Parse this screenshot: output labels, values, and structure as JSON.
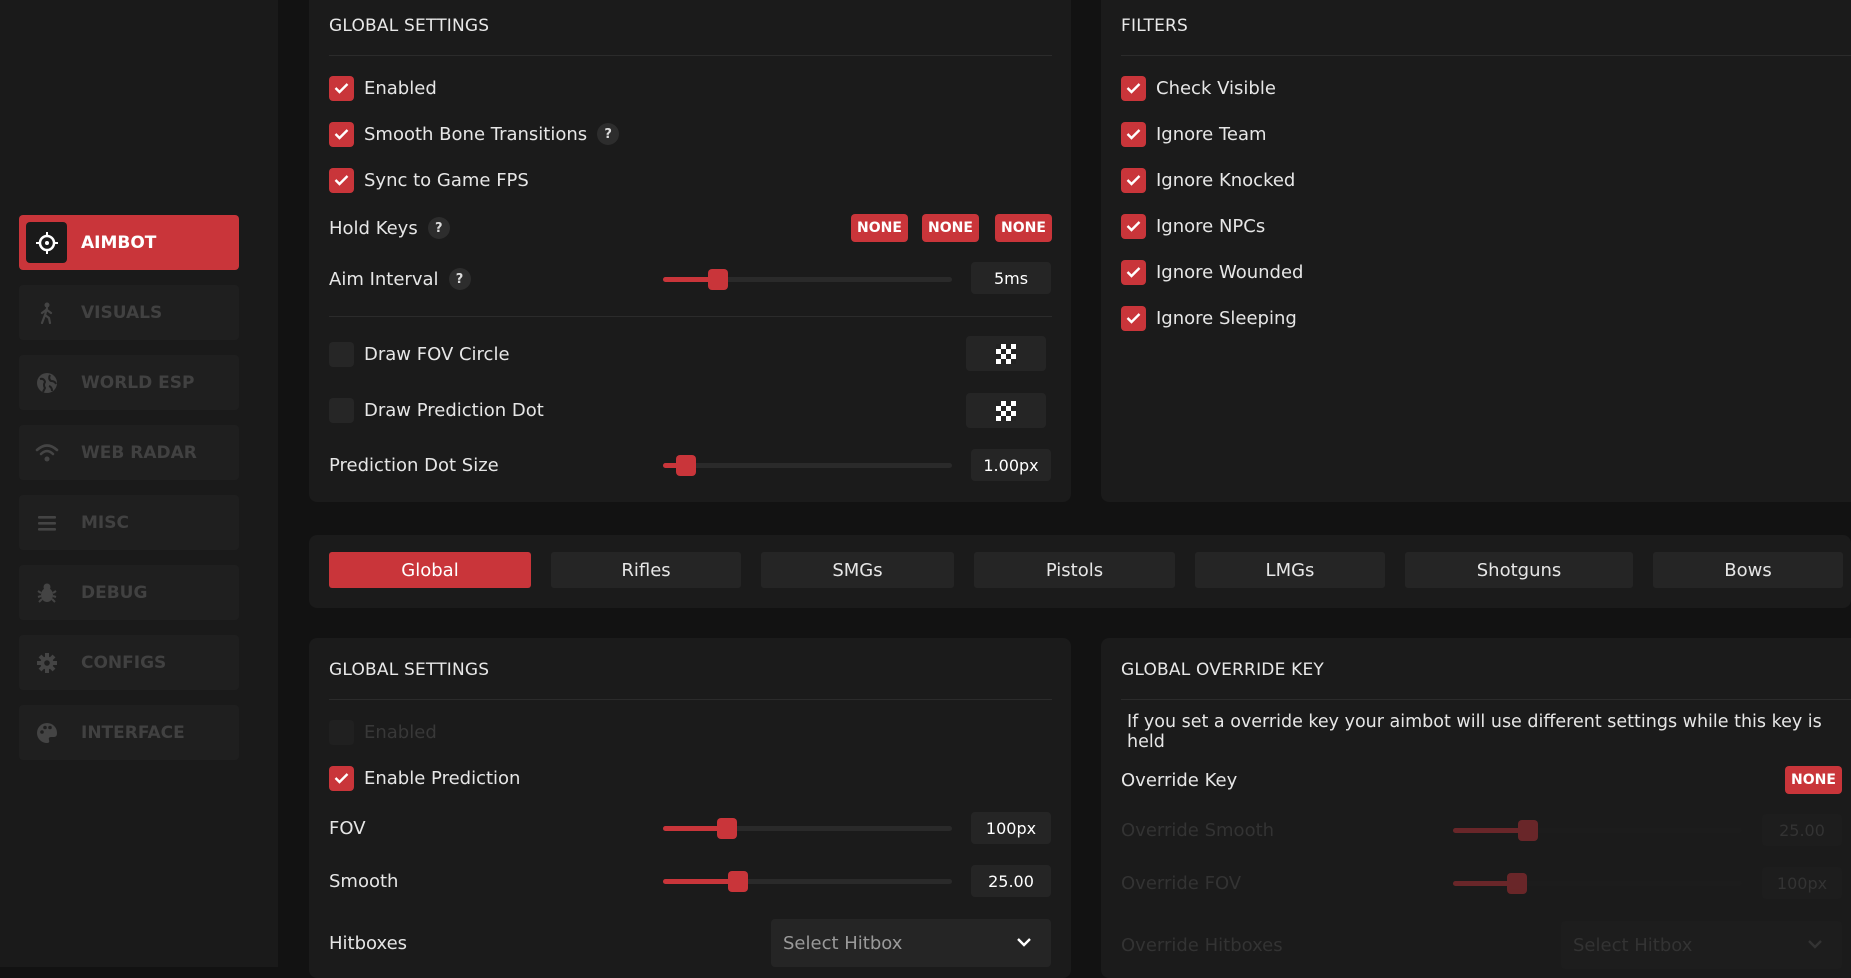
{
  "sidebar": {
    "items": [
      {
        "label": "AIMBOT",
        "icon": "crosshair-icon",
        "active": true
      },
      {
        "label": "VISUALS",
        "icon": "walking-person-icon",
        "active": false
      },
      {
        "label": "WORLD ESP",
        "icon": "globe-icon",
        "active": false
      },
      {
        "label": "WEB RADAR",
        "icon": "wifi-icon",
        "active": false
      },
      {
        "label": "MISC",
        "icon": "menu-lines-icon",
        "active": false
      },
      {
        "label": "DEBUG",
        "icon": "bug-icon",
        "active": false
      },
      {
        "label": "CONFIGS",
        "icon": "gear-icon",
        "active": false
      },
      {
        "label": "INTERFACE",
        "icon": "palette-icon",
        "active": false
      }
    ]
  },
  "global_settings": {
    "title": "GLOBAL SETTINGS",
    "enabled": "Enabled",
    "smooth_bone": "Smooth Bone Transitions",
    "sync_fps": "Sync to Game FPS",
    "hold_keys": "Hold Keys",
    "hold_key_values": [
      "NONE",
      "NONE",
      "NONE"
    ],
    "aim_interval": "Aim Interval",
    "aim_interval_value": "5ms",
    "aim_interval_level": 0.19,
    "draw_fov_circle": "Draw FOV Circle",
    "draw_prediction_dot": "Draw Prediction Dot",
    "prediction_dot_size": "Prediction Dot Size",
    "prediction_dot_size_value": "1.00px",
    "prediction_dot_size_level": 0.08,
    "help": "?"
  },
  "filters": {
    "title": "FILTERS",
    "items": [
      "Check Visible",
      "Ignore Team",
      "Ignore Knocked",
      "Ignore NPCs",
      "Ignore Wounded",
      "Ignore Sleeping"
    ]
  },
  "tabs": [
    "Global",
    "Rifles",
    "SMGs",
    "Pistols",
    "LMGs",
    "Shotguns",
    "Bows"
  ],
  "weapon_settings": {
    "title": "GLOBAL SETTINGS",
    "enabled": "Enabled",
    "enable_prediction": "Enable Prediction",
    "fov": "FOV",
    "fov_value": "100px",
    "fov_level": 0.22,
    "smooth": "Smooth",
    "smooth_value": "25.00",
    "smooth_level": 0.26,
    "hitboxes": "Hitboxes",
    "hitbox_placeholder": "Select Hitbox"
  },
  "override": {
    "title": "GLOBAL OVERRIDE KEY",
    "description": "If you set a override key your aimbot will use different settings while this key is held",
    "override_key": "Override Key",
    "override_key_value": "NONE",
    "override_smooth": "Override Smooth",
    "override_smooth_value": "25.00",
    "override_smooth_level": 0.26,
    "override_fov": "Override FOV",
    "override_fov_value": "100px",
    "override_fov_level": 0.22,
    "override_hitboxes": "Override Hitboxes",
    "override_hitbox_placeholder": "Select Hitbox"
  },
  "colors": {
    "accent": "#c9353a",
    "panel": "#1b1b1b",
    "background": "#121212"
  }
}
